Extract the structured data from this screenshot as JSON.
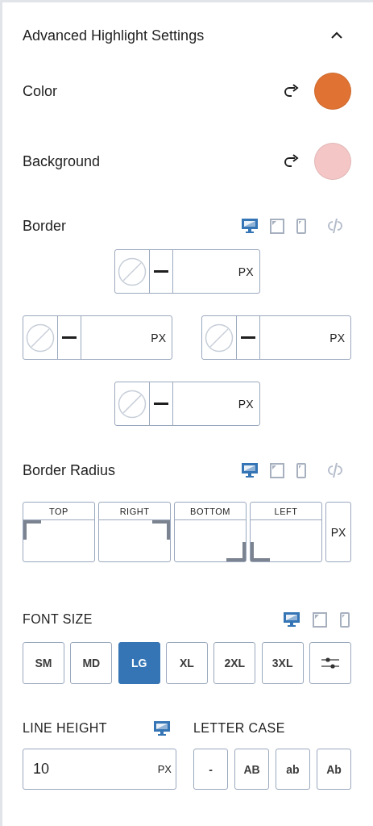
{
  "panel": {
    "title": "Advanced Highlight Settings",
    "expanded": true
  },
  "colors": [
    {
      "label": "Color",
      "color": "#e07333"
    },
    {
      "label": "Background",
      "color": "#f5c6c6"
    }
  ],
  "border": {
    "label": "Border",
    "devices": [
      {
        "kind": "desktop",
        "selected": true
      },
      {
        "kind": "tablet",
        "selected": false
      },
      {
        "kind": "mobile",
        "selected": false
      }
    ],
    "linked": false,
    "sides": [
      {
        "unit": "PX"
      },
      {
        "unit": "PX"
      },
      {
        "unit": "PX"
      },
      {
        "unit": "PX"
      }
    ]
  },
  "border_radius": {
    "label": "Border Radius",
    "devices": [
      {
        "kind": "desktop",
        "selected": true
      },
      {
        "kind": "tablet",
        "selected": false
      },
      {
        "kind": "mobile",
        "selected": false
      }
    ],
    "linked": false,
    "corners": [
      {
        "label": "TOP",
        "kind": "top-left"
      },
      {
        "label": "RIGHT",
        "kind": "top-right"
      },
      {
        "label": "BOTTOM",
        "kind": "bottom-right"
      },
      {
        "label": "LEFT",
        "kind": "bottom-left"
      }
    ],
    "unit": "PX"
  },
  "font_size": {
    "label": "FONT SIZE",
    "devices": [
      {
        "kind": "desktop",
        "selected": true
      },
      {
        "kind": "tablet",
        "selected": false
      },
      {
        "kind": "mobile",
        "selected": false
      }
    ],
    "options": [
      {
        "kind": "preset",
        "label": "SM",
        "selected": false
      },
      {
        "kind": "preset",
        "label": "MD",
        "selected": false
      },
      {
        "kind": "preset",
        "label": "LG",
        "selected": true
      },
      {
        "kind": "preset",
        "label": "XL",
        "selected": false
      },
      {
        "kind": "preset",
        "label": "2XL",
        "selected": false
      },
      {
        "kind": "preset",
        "label": "3XL",
        "selected": false
      },
      {
        "kind": "custom",
        "selected": false
      }
    ]
  },
  "line_height": {
    "label": "LINE HEIGHT",
    "devices": [
      {
        "kind": "desktop",
        "selected": true
      }
    ],
    "value": "10",
    "unit": "PX"
  },
  "letter_case": {
    "label": "LETTER CASE",
    "options": [
      {
        "label": "-",
        "selected": false
      },
      {
        "label": "AB",
        "selected": false
      },
      {
        "label": "ab",
        "selected": false
      },
      {
        "label": "Ab",
        "selected": false
      }
    ]
  }
}
